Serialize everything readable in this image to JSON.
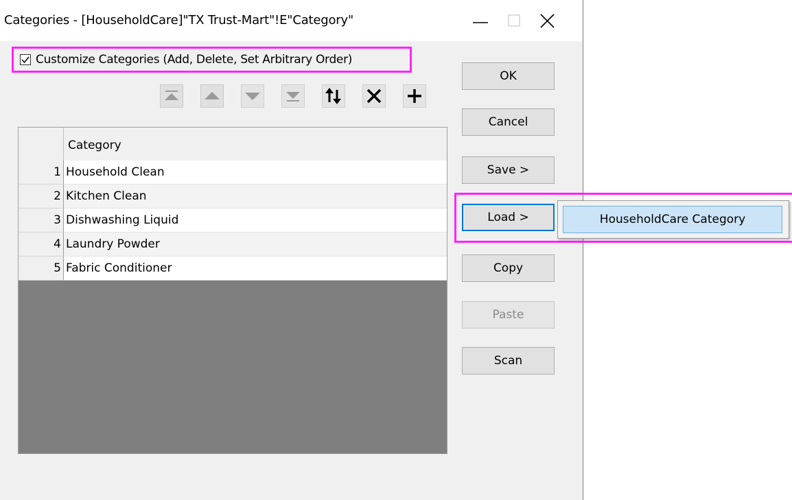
{
  "window": {
    "title": "Categories - [HouseholdCare]\"TX Trust-Mart\"!E\"Category\""
  },
  "customize": {
    "label": "Customize Categories (Add, Delete, Set Arbitrary Order)",
    "checked": true
  },
  "toolbar": {
    "icons": [
      "move-to-top-icon",
      "move-up-icon",
      "move-down-icon",
      "move-to-bottom-icon",
      "reverse-order-icon",
      "delete-icon",
      "add-icon"
    ]
  },
  "grid": {
    "header": "Category",
    "rows": [
      {
        "num": "1",
        "value": "Household Clean"
      },
      {
        "num": "2",
        "value": "Kitchen Clean"
      },
      {
        "num": "3",
        "value": "Dishwashing Liquid"
      },
      {
        "num": "4",
        "value": "Laundry Powder"
      },
      {
        "num": "5",
        "value": "Fabric Conditioner"
      }
    ]
  },
  "buttons": {
    "ok": "OK",
    "cancel": "Cancel",
    "save": "Save >",
    "load": "Load >",
    "copy": "Copy",
    "paste": "Paste",
    "scan": "Scan"
  },
  "load_menu": {
    "items": [
      "HouseholdCare Category"
    ]
  },
  "colors": {
    "highlight": "#ff22ff",
    "focus": "#0078d7",
    "menu_hover": "#cce4f7"
  }
}
